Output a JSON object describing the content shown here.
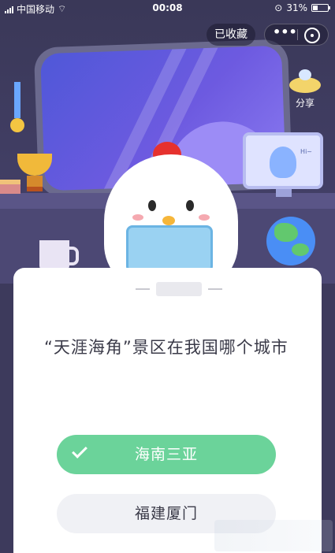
{
  "status_bar": {
    "carrier": "中国移动",
    "time": "00:08",
    "battery_percent_text": "31%",
    "battery_level": 0.31,
    "icons": [
      "signal-icon",
      "wifi-icon",
      "rotation-lock-icon",
      "battery-icon"
    ]
  },
  "header": {
    "favorited_label": "已收藏",
    "more_icon": "more-dots-icon",
    "close_icon": "close-circle-icon",
    "share_label": "分享"
  },
  "scene": {
    "monitor_text": "Hi~"
  },
  "quiz": {
    "question": "“天涯海角”景区在我国哪个城市",
    "options": [
      {
        "label": "海南三亚",
        "state": "correct",
        "icon": "check-icon"
      },
      {
        "label": "福建厦门",
        "state": "normal"
      }
    ]
  },
  "colors": {
    "correct": "#6bd39a",
    "background": "#3d3a5c",
    "card": "#ffffff"
  }
}
